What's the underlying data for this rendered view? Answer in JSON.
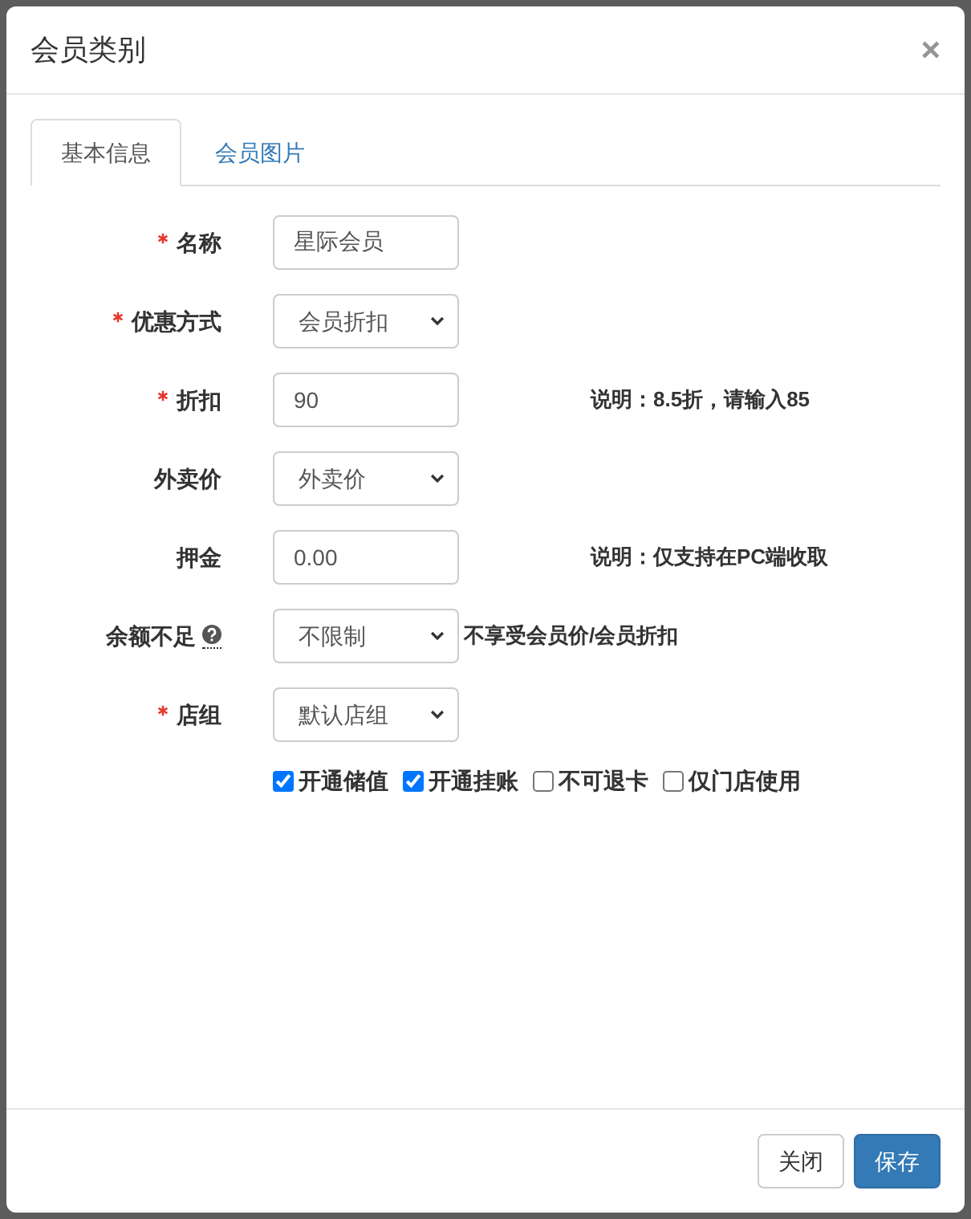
{
  "dialog": {
    "title": "会员类别",
    "close": "×"
  },
  "tabs": [
    {
      "label": "基本信息",
      "selected": true
    },
    {
      "label": "会员图片",
      "selected": false
    }
  ],
  "fields": [
    {
      "label": "名称",
      "required": true,
      "kind": "text",
      "value": "星际会员"
    },
    {
      "label": "优惠方式",
      "required": true,
      "kind": "select",
      "value": "会员折扣"
    },
    {
      "label": "折扣",
      "required": true,
      "kind": "text",
      "value": "90",
      "note": "说明：8.5折，请输入85"
    },
    {
      "label": "外卖价",
      "required": false,
      "kind": "select",
      "value": "外卖价"
    },
    {
      "label": "押金",
      "required": false,
      "kind": "text",
      "value": "0.00",
      "note": "说明：仅支持在PC端收取"
    },
    {
      "label": "余额不足",
      "required": false,
      "help": true,
      "kind": "select",
      "value": "不限制",
      "suffix": "不享受会员价/会员折扣"
    },
    {
      "label": "店组",
      "required": true,
      "kind": "select",
      "value": "默认店组"
    }
  ],
  "options": [
    {
      "label": "开通储值",
      "checked": true
    },
    {
      "label": "开通挂账",
      "checked": true
    },
    {
      "label": "不可退卡",
      "checked": false
    },
    {
      "label": "仅门店使用",
      "checked": false
    }
  ],
  "buttons": [
    {
      "label": "关闭",
      "kind": "default"
    },
    {
      "label": "保存",
      "kind": "primary"
    }
  ]
}
